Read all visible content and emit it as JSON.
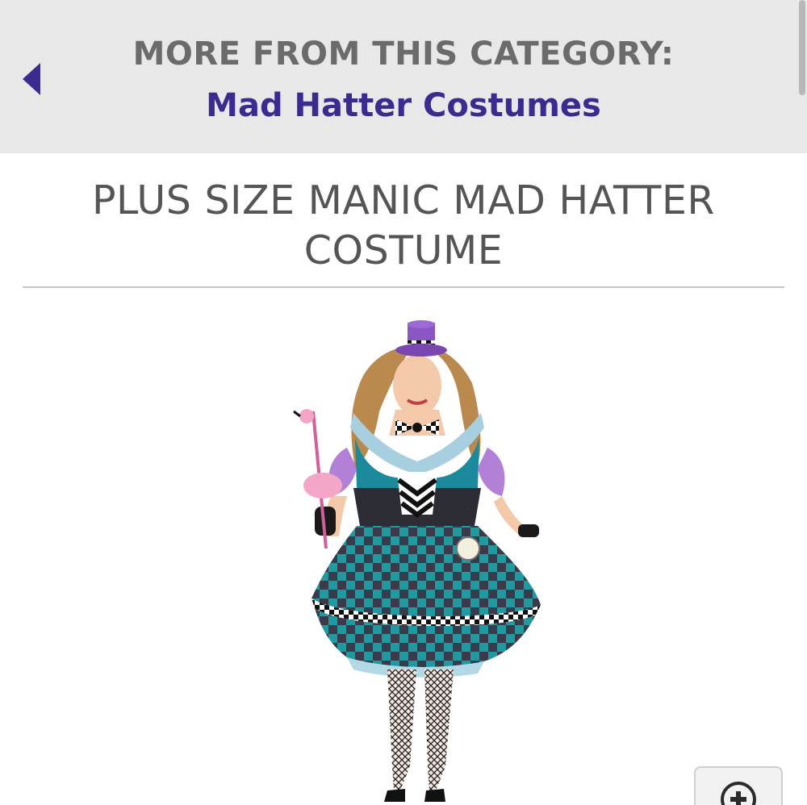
{
  "category_bar": {
    "heading": "MORE FROM THIS CATEGORY:",
    "link_label": "Mad Hatter Costumes",
    "back_icon": "triangle-left-icon"
  },
  "product": {
    "title": "PLUS SIZE MANIC MAD HATTER COSTUME",
    "image_alt": "Plus Size Manic Mad Hatter Costume",
    "zoom_icon": "zoom-plus-icon"
  },
  "colors": {
    "banner_bg": "#e8e8e8",
    "heading_gray": "#6b6b6b",
    "link_purple": "#3b2a8f",
    "title_gray": "#555555"
  }
}
